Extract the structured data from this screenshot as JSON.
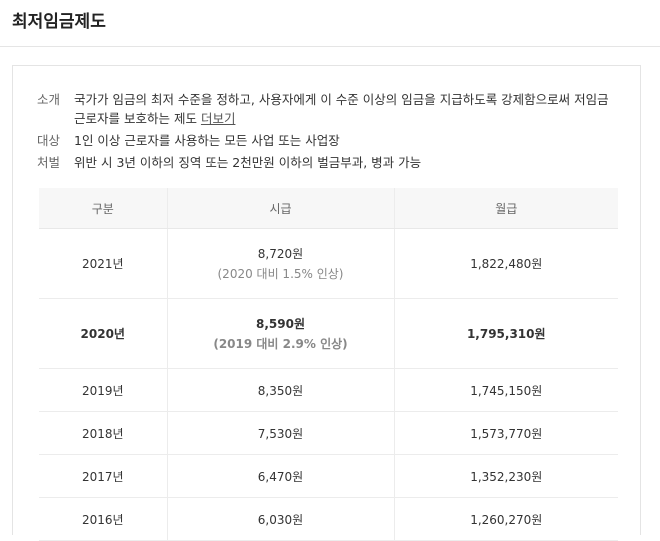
{
  "page_title": "최저임금제도",
  "info": [
    {
      "label": "소개",
      "text": "국가가 임금의 최저 수준을 정하고, 사용자에게 이 수준 이상의 임금을 지급하도록 강제함으로써 저임금 근로자를 보호하는 제도",
      "link": "더보기"
    },
    {
      "label": "대상",
      "text": "1인 이상 근로자를 사용하는 모든 사업 또는 사업장"
    },
    {
      "label": "처벌",
      "text": "위반 시 3년 이하의 징역 또는 2천만원 이하의 벌금부과, 병과 가능"
    }
  ],
  "table": {
    "headers": [
      "구분",
      "시급",
      "월급"
    ],
    "rows": [
      {
        "year": "2021년",
        "hourly": "8,720원",
        "note": "(2020 대비 1.5% 인상)",
        "monthly": "1,822,480원"
      },
      {
        "year": "2020년",
        "hourly": "8,590원",
        "note": "(2019 대비 2.9% 인상)",
        "monthly": "1,795,310원"
      },
      {
        "year": "2019년",
        "hourly": "8,350원",
        "monthly": "1,745,150원"
      },
      {
        "year": "2018년",
        "hourly": "7,530원",
        "monthly": "1,573,770원"
      },
      {
        "year": "2017년",
        "hourly": "6,470원",
        "monthly": "1,352,230원"
      },
      {
        "year": "2016년",
        "hourly": "6,030원",
        "monthly": "1,260,270원"
      }
    ]
  }
}
